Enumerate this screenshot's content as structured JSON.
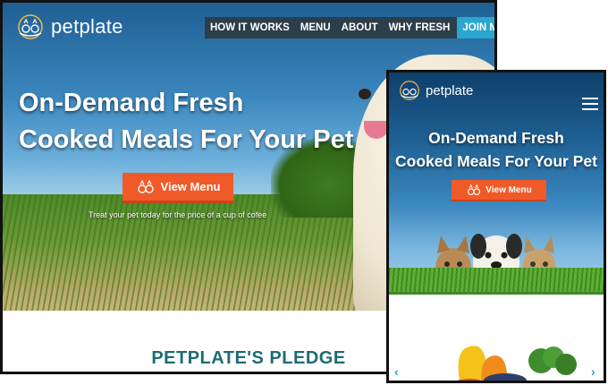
{
  "brand": {
    "name": "petplate"
  },
  "desktop": {
    "nav": [
      "HOW IT WORKS",
      "MENU",
      "ABOUT",
      "WHY FRESH"
    ],
    "join_label": "JOIN MAILING LIST",
    "headline_line1": "On-Demand Fresh",
    "headline_line2": "Cooked Meals For Your Pet",
    "cta_label": "View Menu",
    "tagline": "Treat your pet today for the price of a cup of cofee",
    "section_title": "PETPLATE'S PLEDGE"
  },
  "mobile": {
    "headline_line1": "On-Demand Fresh",
    "headline_line2": "Cooked Meals For Your Pet",
    "cta_label": "View Menu",
    "prev_arrow": "‹",
    "next_arrow": "›"
  },
  "icons": {
    "logo": "petplate-logo-icon",
    "cta": "food-bowls-icon",
    "menu": "hamburger-menu-icon"
  },
  "colors": {
    "accent_orange": "#f05a28",
    "join_blue": "#2aa6cf",
    "nav_dark": "#2c3e4a",
    "pledge_teal": "#1f6b73"
  }
}
